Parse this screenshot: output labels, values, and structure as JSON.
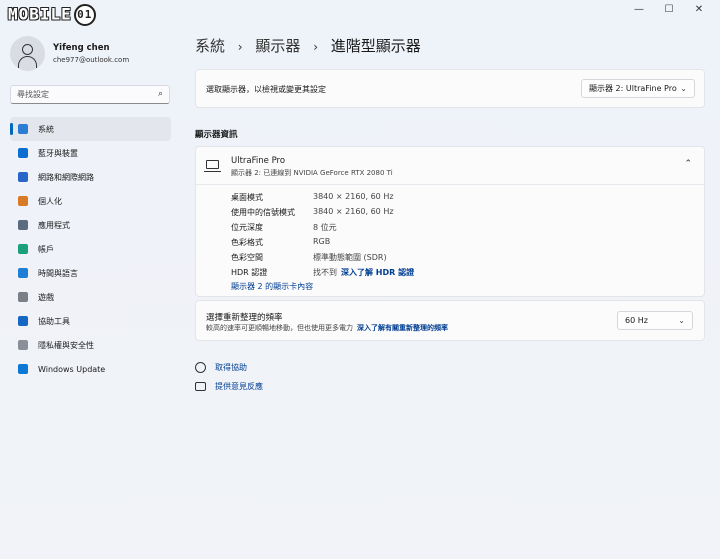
{
  "logo": {
    "text": "MOBILE",
    "mark": "01"
  },
  "window_controls": {
    "minimize": "—",
    "maximize": "☐",
    "close": "✕"
  },
  "user": {
    "name": "Yifeng chen",
    "email": "che977@outlook.com"
  },
  "search": {
    "placeholder": "尋找設定",
    "icon": "search-icon"
  },
  "nav": {
    "items": [
      {
        "label": "系統",
        "icon": "system-icon",
        "color": "#2b7cd3"
      },
      {
        "label": "藍牙與裝置",
        "icon": "bluetooth-icon",
        "color": "#0a6fd1"
      },
      {
        "label": "網路和網際網路",
        "icon": "network-icon",
        "color": "#2a66c9"
      },
      {
        "label": "個人化",
        "icon": "brush-icon",
        "color": "#d97a26"
      },
      {
        "label": "應用程式",
        "icon": "apps-icon",
        "color": "#5b6b80"
      },
      {
        "label": "帳戶",
        "icon": "account-icon",
        "color": "#1aa07a"
      },
      {
        "label": "時間與語言",
        "icon": "globe-clock-icon",
        "color": "#1f7ed6"
      },
      {
        "label": "遊戲",
        "icon": "gamepad-icon",
        "color": "#7a7f88"
      },
      {
        "label": "協助工具",
        "icon": "accessibility-icon",
        "color": "#1468c4"
      },
      {
        "label": "隱私權與安全性",
        "icon": "shield-icon",
        "color": "#8a8f99"
      },
      {
        "label": "Windows Update",
        "icon": "update-icon",
        "color": "#0a78d4"
      }
    ]
  },
  "breadcrumb": {
    "part1": "系統",
    "part2": "顯示器",
    "current": "進階型顯示器",
    "sep": "›"
  },
  "select_display": {
    "label": "選取顯示器，以檢視或變更其設定",
    "value": "顯示器 2: UltraFine Pro"
  },
  "section_title": "顯示器資訊",
  "display_info": {
    "name": "UltraFine Pro",
    "subtitle": "顯示器 2: 已連線到 NVIDIA GeForce RTX 2080 Ti",
    "rows": [
      {
        "key": "桌面模式",
        "value": "3840 × 2160, 60 Hz"
      },
      {
        "key": "使用中的信號模式",
        "value": "3840 × 2160, 60 Hz"
      },
      {
        "key": "位元深度",
        "value": "8 位元"
      },
      {
        "key": "色彩格式",
        "value": "RGB"
      },
      {
        "key": "色彩空間",
        "value": "標準動態範圍 (SDR)"
      },
      {
        "key": "HDR 認證",
        "value": "找不到",
        "link": "深入了解 HDR 認證"
      }
    ],
    "adapter_link": "顯示器 2 的顯示卡內容"
  },
  "refresh": {
    "title": "選擇重新整理的頻率",
    "desc": "較高的速率可更順暢地移動，但也使用更多電力",
    "link": "深入了解有關重新整理的頻率",
    "value": "60 Hz"
  },
  "footer": {
    "help": "取得協助",
    "feedback": "提供意見反應"
  }
}
